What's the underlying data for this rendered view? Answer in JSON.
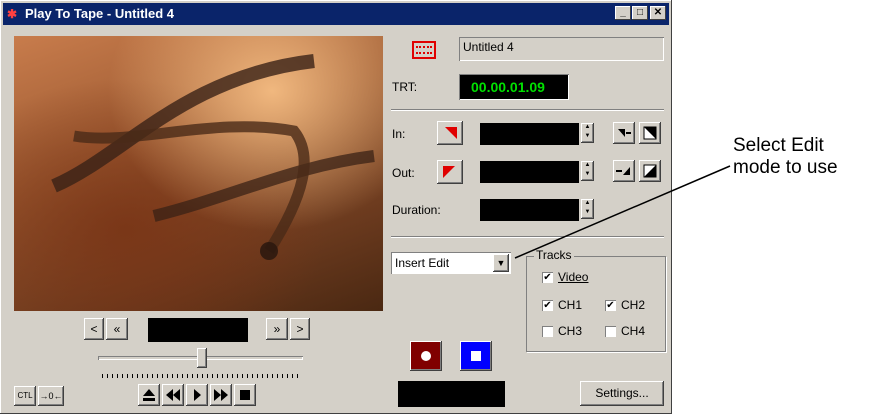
{
  "window": {
    "title": "Play To Tape - Untitled 4",
    "controls": {
      "minimize": "_",
      "maximize": "□",
      "close": "✕"
    }
  },
  "sequence_name": "Untitled 4",
  "trt": {
    "label": "TRT:",
    "value": "00.00.01.09",
    "value_color": "#00e000"
  },
  "in_point": {
    "label": "In:",
    "value": ""
  },
  "out_point": {
    "label": "Out:",
    "value": ""
  },
  "duration": {
    "label": "Duration:",
    "value": ""
  },
  "edit_mode": {
    "selected": "Insert Edit"
  },
  "tracks": {
    "title": "Tracks",
    "video": {
      "label": "Video",
      "checked": true
    },
    "ch1": {
      "label": "CH1",
      "checked": true
    },
    "ch2": {
      "label": "CH2",
      "checked": true
    },
    "ch3": {
      "label": "CH3",
      "checked": false
    },
    "ch4": {
      "label": "CH4",
      "checked": false
    }
  },
  "transport": {
    "prev_label": "<",
    "rewind_fast_label": "«",
    "fwd_fast_label": "»",
    "next_label": ">",
    "timecode": "",
    "ctl_label": "CTL",
    "offset_label": "→0←"
  },
  "record_status": "",
  "settings_label": "Settings...",
  "callout": {
    "text_line1": "Select Edit",
    "text_line2": "mode to use"
  },
  "colors": {
    "titlebar": "#0a246a",
    "record": "#800000",
    "stop": "#0000ff"
  }
}
